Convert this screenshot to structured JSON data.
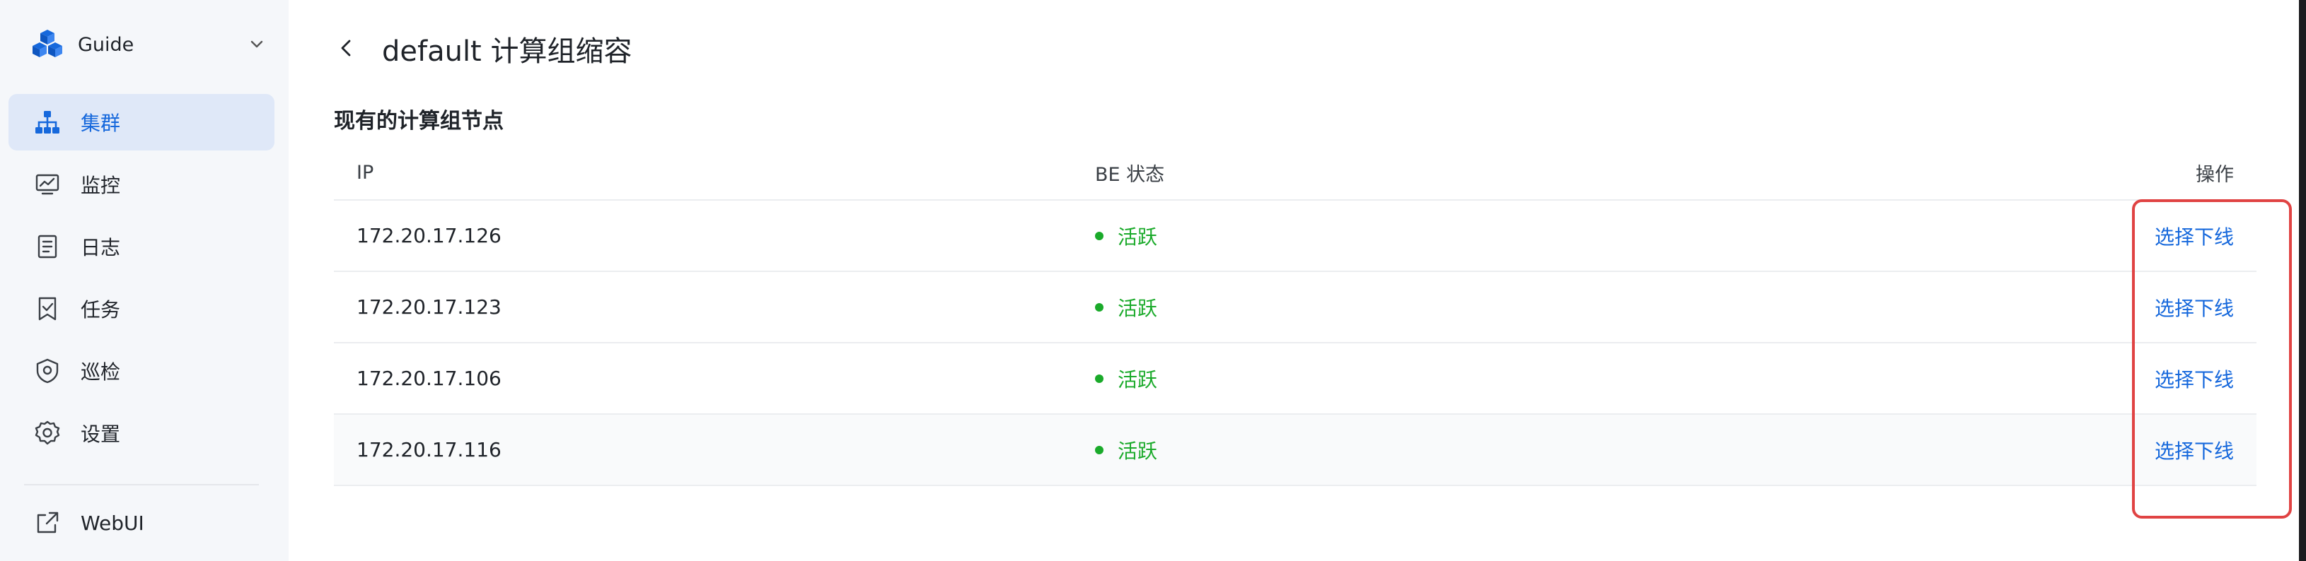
{
  "sidebar": {
    "brand": "Guide",
    "items": [
      {
        "label": "集群",
        "icon": "cluster-icon",
        "active": true
      },
      {
        "label": "监控",
        "icon": "monitor-icon",
        "active": false
      },
      {
        "label": "日志",
        "icon": "log-icon",
        "active": false
      },
      {
        "label": "任务",
        "icon": "task-icon",
        "active": false
      },
      {
        "label": "巡检",
        "icon": "shield-icon",
        "active": false
      },
      {
        "label": "设置",
        "icon": "gear-icon",
        "active": false
      }
    ],
    "footer": {
      "label": "WebUI",
      "icon": "external-link-icon"
    }
  },
  "main": {
    "title": "default 计算组缩容",
    "section_title": "现有的计算组节点",
    "table": {
      "headers": {
        "ip": "IP",
        "status": "BE 状态",
        "op": "操作"
      },
      "rows": [
        {
          "ip": "172.20.17.126",
          "status": "活跃",
          "op": "选择下线"
        },
        {
          "ip": "172.20.17.123",
          "status": "活跃",
          "op": "选择下线"
        },
        {
          "ip": "172.20.17.106",
          "status": "活跃",
          "op": "选择下线"
        },
        {
          "ip": "172.20.17.116",
          "status": "活跃",
          "op": "选择下线"
        }
      ]
    }
  },
  "colors": {
    "accent": "#1668dc",
    "active_bg": "#dfe8f8",
    "status_green": "#1aaa2a",
    "highlight_red": "#e04343"
  }
}
